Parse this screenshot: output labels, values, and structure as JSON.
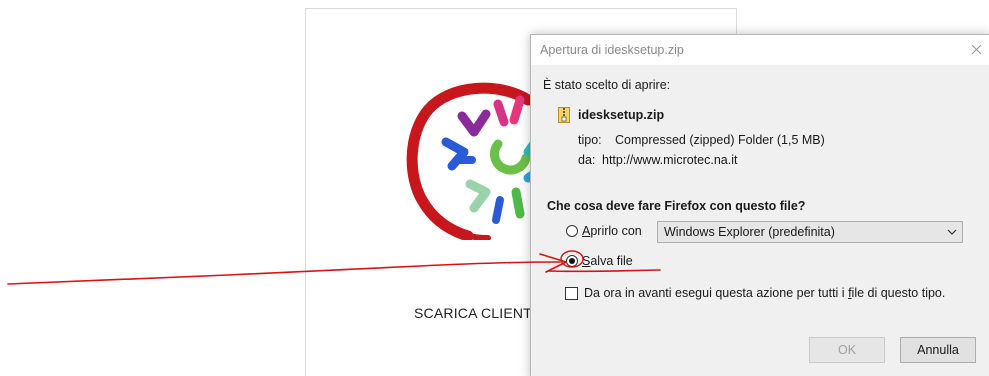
{
  "background_page": {
    "caption": "SCARICA CLIENT"
  },
  "dialog": {
    "title": "Apertura di idesksetup.zip",
    "intro": "È stato scelto di aprire:",
    "file": {
      "name": "idesksetup.zip",
      "type_label": "tipo:",
      "type_value": "Compressed (zipped) Folder (1,5 MB)",
      "from_label": "da:",
      "from_value": "http://www.microtec.na.it"
    },
    "question": "Che cosa deve fare Firefox con questo file?",
    "options": {
      "open_with": {
        "label_mnemonic": "A",
        "label_rest": "prirlo con",
        "selected": false,
        "app": "Windows Explorer (predefinita)"
      },
      "save_file": {
        "label_mnemonic": "S",
        "label_rest": "alva file",
        "selected": true
      }
    },
    "remember": {
      "label_before": "Da ora in avanti esegui questa azione per tutti i ",
      "label_mnemonic": "f",
      "label_after": "ile di questo tipo.",
      "checked": false
    },
    "buttons": {
      "ok": "OK",
      "cancel": "Annulla"
    }
  },
  "colors": {
    "annotation": "#d81313",
    "logo_ring": "#c8161d",
    "dialog_bg": "#f0f0f0"
  }
}
